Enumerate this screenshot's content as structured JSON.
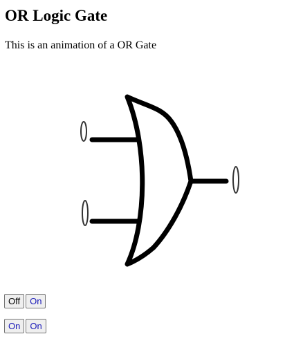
{
  "page": {
    "title": "OR Logic Gate",
    "description": "This is an animation of a OR Gate"
  },
  "gate": {
    "type": "OR",
    "stroke_color": "#000000",
    "fill_color": "#ffffff",
    "input_a_state": "off",
    "input_b_state": "on",
    "output_state": "off"
  },
  "controls": {
    "row1": {
      "off_button_label": "Off",
      "on_button_label": "On"
    },
    "row2": {
      "first_on_button_label": "On",
      "second_on_button_label": "On"
    },
    "on_label_color": "#1a1ab8"
  }
}
